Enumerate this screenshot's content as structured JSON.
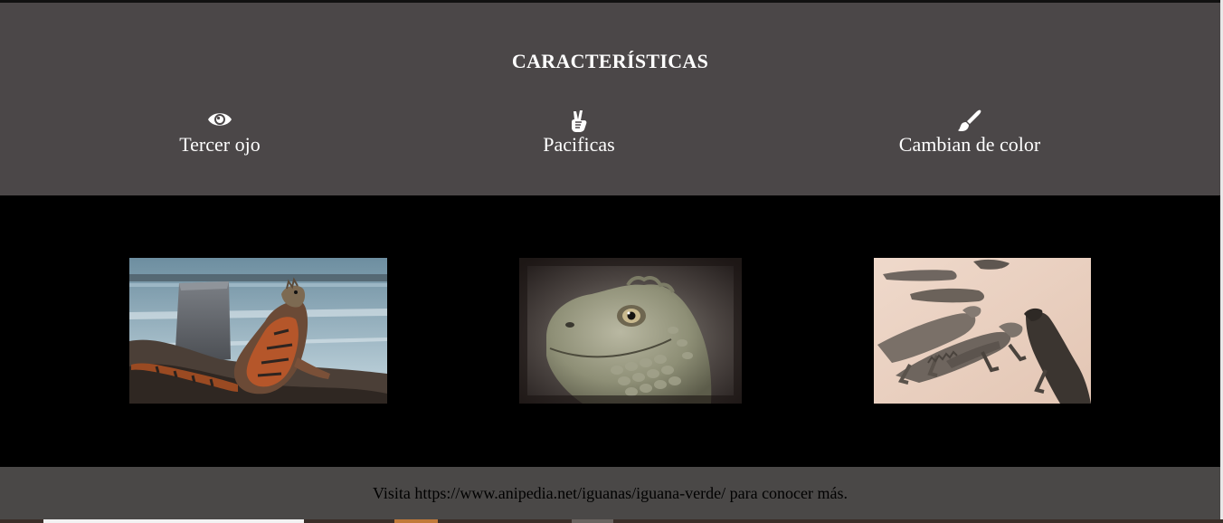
{
  "features": {
    "title": "CARACTERÍSTICAS",
    "items": [
      {
        "icon": "eye-icon",
        "label": "Tercer ojo"
      },
      {
        "icon": "peace-hand-icon",
        "label": "Pacificas"
      },
      {
        "icon": "paintbrush-icon",
        "label": "Cambian de color"
      }
    ]
  },
  "gallery": {
    "photos": [
      {
        "subject": "iguana-on-shore-photo"
      },
      {
        "subject": "iguana-head-closeup-photo"
      },
      {
        "subject": "iguanas-on-beach-photo"
      }
    ]
  },
  "footer": {
    "text": "Visita https://www.anipedia.net/iguanas/iguana-verde/ para conocer más."
  },
  "colors": {
    "features_bg": "#4b4748",
    "gallery_bg": "#000000",
    "footer_bg": "#4a4847",
    "text_light": "#ffffff",
    "text_dark": "#000000"
  }
}
